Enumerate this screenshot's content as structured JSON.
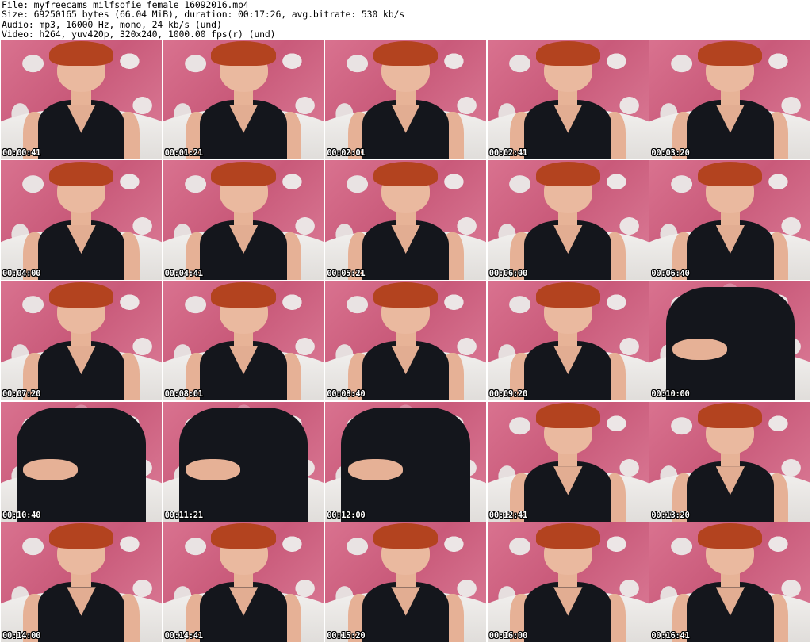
{
  "header": {
    "file_line": "File: myfreecams_milfsofie_female_16092016.mp4",
    "size_line": "Size: 69250165 bytes (66.04 MiB), duration: 00:17:26, avg.bitrate: 530 kb/s",
    "audio_line": "Audio: mp3, 16000 Hz, mono, 24 kb/s (und)",
    "video_line": "Video: h264, yuv420p, 320x240, 1000.00 fps(r) (und)"
  },
  "thumbnails": [
    {
      "timestamp": "00:00:41",
      "scene": "portrait"
    },
    {
      "timestamp": "00:01:21",
      "scene": "portrait"
    },
    {
      "timestamp": "00:02:01",
      "scene": "portrait"
    },
    {
      "timestamp": "00:02:41",
      "scene": "portrait"
    },
    {
      "timestamp": "00:03:20",
      "scene": "portrait"
    },
    {
      "timestamp": "00:04:00",
      "scene": "portrait"
    },
    {
      "timestamp": "00:04:41",
      "scene": "portrait"
    },
    {
      "timestamp": "00:05:21",
      "scene": "portrait"
    },
    {
      "timestamp": "00:06:00",
      "scene": "portrait"
    },
    {
      "timestamp": "00:06:40",
      "scene": "portrait"
    },
    {
      "timestamp": "00:07:20",
      "scene": "portrait"
    },
    {
      "timestamp": "00:08:01",
      "scene": "portrait"
    },
    {
      "timestamp": "00:08:40",
      "scene": "portrait"
    },
    {
      "timestamp": "00:09:20",
      "scene": "portrait"
    },
    {
      "timestamp": "00:10:00",
      "scene": "closeup"
    },
    {
      "timestamp": "00:10:40",
      "scene": "closeup"
    },
    {
      "timestamp": "00:11:21",
      "scene": "closeup"
    },
    {
      "timestamp": "00:12:00",
      "scene": "closeup"
    },
    {
      "timestamp": "00:12:41",
      "scene": "portrait"
    },
    {
      "timestamp": "00:13:20",
      "scene": "portrait"
    },
    {
      "timestamp": "00:14:00",
      "scene": "portrait"
    },
    {
      "timestamp": "00:14:41",
      "scene": "portrait"
    },
    {
      "timestamp": "00:15:20",
      "scene": "portrait"
    },
    {
      "timestamp": "00:16:00",
      "scene": "portrait"
    },
    {
      "timestamp": "00:16:41",
      "scene": "portrait"
    }
  ]
}
